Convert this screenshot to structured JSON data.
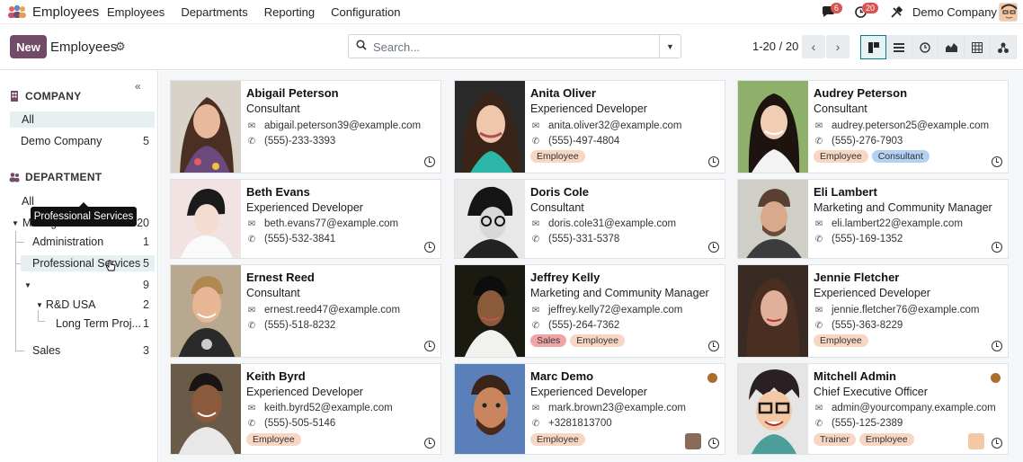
{
  "navbar": {
    "app_name": "Employees",
    "menu": [
      "Employees",
      "Departments",
      "Reporting",
      "Configuration"
    ],
    "messages_badge": "6",
    "activity_badge": "20",
    "company": "Demo Company"
  },
  "control": {
    "new_label": "New",
    "title": "Employees",
    "search_placeholder": "Search...",
    "pager": "1-20 / 20"
  },
  "sidebar": {
    "company_heading": "COMPANY",
    "companies": [
      {
        "label": "All",
        "count": ""
      },
      {
        "label": "Demo Company",
        "count": "5"
      }
    ],
    "department_heading": "DEPARTMENT",
    "departments": [
      {
        "label": "All",
        "count": ""
      },
      {
        "label": "Management",
        "count": "20"
      },
      {
        "label": "Administration",
        "count": "1"
      },
      {
        "label": "Professional Services",
        "count": "5"
      },
      {
        "label": "",
        "count": "9"
      },
      {
        "label": "R&D USA",
        "count": "2"
      },
      {
        "label": "Long Term Proj...",
        "count": "1"
      },
      {
        "label": "Sales",
        "count": "3"
      }
    ],
    "tooltip": "Professional Services"
  },
  "employees": [
    {
      "name": "Abigail Peterson",
      "job": "Consultant",
      "email": "abigail.peterson39@example.com",
      "phone": "(555)-233-3393",
      "tags": []
    },
    {
      "name": "Anita Oliver",
      "job": "Experienced Developer",
      "email": "anita.oliver32@example.com",
      "phone": "(555)-497-4804",
      "tags": [
        "Employee"
      ]
    },
    {
      "name": "Audrey Peterson",
      "job": "Consultant",
      "email": "audrey.peterson25@example.com",
      "phone": "(555)-276-7903",
      "tags": [
        "Employee",
        "Consultant"
      ]
    },
    {
      "name": "Beth Evans",
      "job": "Experienced Developer",
      "email": "beth.evans77@example.com",
      "phone": "(555)-532-3841",
      "tags": []
    },
    {
      "name": "Doris Cole",
      "job": "Consultant",
      "email": "doris.cole31@example.com",
      "phone": "(555)-331-5378",
      "tags": []
    },
    {
      "name": "Eli Lambert",
      "job": "Marketing and Community Manager",
      "email": "eli.lambert22@example.com",
      "phone": "(555)-169-1352",
      "tags": []
    },
    {
      "name": "Ernest Reed",
      "job": "Consultant",
      "email": "ernest.reed47@example.com",
      "phone": "(555)-518-8232",
      "tags": []
    },
    {
      "name": "Jeffrey Kelly",
      "job": "Marketing and Community Manager",
      "email": "jeffrey.kelly72@example.com",
      "phone": "(555)-264-7362",
      "tags": [
        "Sales",
        "Employee"
      ]
    },
    {
      "name": "Jennie Fletcher",
      "job": "Experienced Developer",
      "email": "jennie.fletcher76@example.com",
      "phone": "(555)-363-8229",
      "tags": [
        "Employee"
      ]
    },
    {
      "name": "Keith Byrd",
      "job": "Experienced Developer",
      "email": "keith.byrd52@example.com",
      "phone": "(555)-505-5146",
      "tags": [
        "Employee"
      ]
    },
    {
      "name": "Marc Demo",
      "job": "Experienced Developer",
      "email": "mark.brown23@example.com",
      "phone": "+3281813700",
      "tags": [
        "Employee"
      ]
    },
    {
      "name": "Mitchell Admin",
      "job": "Chief Executive Officer",
      "email": "admin@yourcompany.example.com",
      "phone": "(555)-125-2389",
      "tags": [
        "Trainer",
        "Employee"
      ]
    }
  ],
  "colors": {
    "brand": "#714b67",
    "accent": "#017e84",
    "tag_employee": "#f7d6c4",
    "tag_consultant": "#b3d1f3",
    "tag_sales": "#f0a5a5"
  }
}
